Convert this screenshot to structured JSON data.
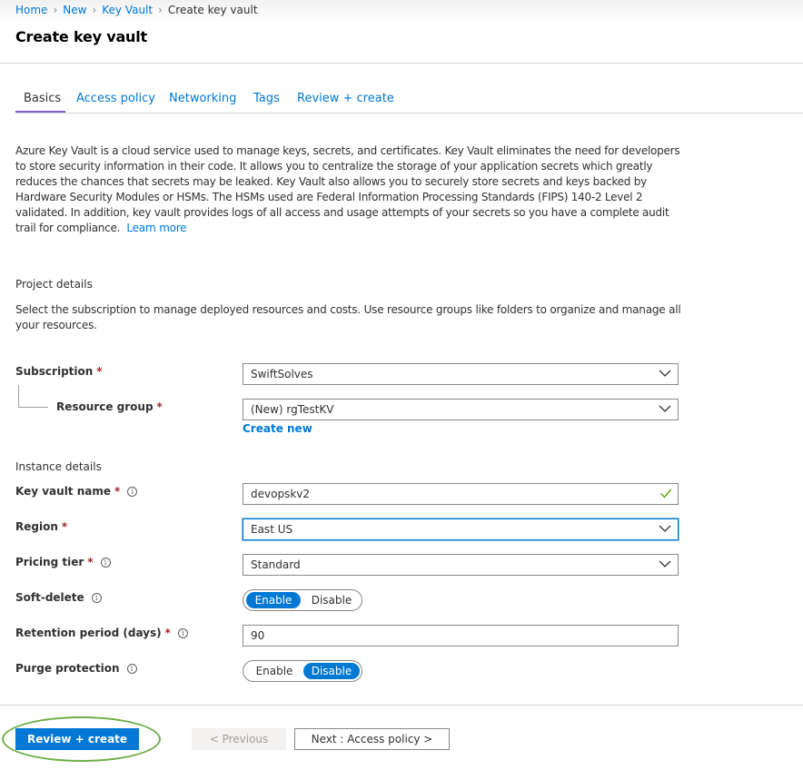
{
  "breadcrumb": [
    "Home",
    "New",
    "Key Vault",
    "Create key vault"
  ],
  "page_title": "Create key vault",
  "tabs": [
    {
      "label": "Basics",
      "active": true
    },
    {
      "label": "Access policy",
      "active": false
    },
    {
      "label": "Networking",
      "active": false
    },
    {
      "label": "Tags",
      "active": false
    },
    {
      "label": "Review + create",
      "active": false
    }
  ],
  "description": {
    "text": "Azure Key Vault is a cloud service used to manage keys, secrets, and certificates. Key Vault eliminates the need for developers to store security information in their code. It allows you to centralize the storage of your application secrets which greatly reduces the chances that secrets may be leaked. Key Vault also allows you to securely store secrets and keys backed by Hardware Security Modules or HSMs. The HSMs used are Federal Information Processing Standards (FIPS) 140-2 Level 2 validated. In addition, key vault provides logs of all access and usage attempts of your secrets so you have a complete audit trail for compliance.",
    "learn_more": "Learn more"
  },
  "project_details": {
    "heading": "Project details",
    "text": "Select the subscription to manage deployed resources and costs. Use resource groups like folders to organize and manage all your resources."
  },
  "subscription": {
    "label": "Subscription",
    "required_mark": "*",
    "value": "SwiftSolves"
  },
  "resource_group": {
    "label": "Resource group",
    "required_mark": "*",
    "value": "(New) rgTestKV",
    "create_new": "Create new"
  },
  "instance_details": {
    "heading": "Instance details"
  },
  "key_vault_name": {
    "label": "Key vault name",
    "required_mark": "*",
    "value": "devopskv2",
    "valid": true
  },
  "region": {
    "label": "Region",
    "required_mark": "*",
    "value": "East US"
  },
  "pricing_tier": {
    "label": "Pricing tier",
    "required_mark": "*",
    "value": "Standard"
  },
  "soft_delete": {
    "label": "Soft-delete",
    "enable": "Enable",
    "disable": "Disable",
    "selected": "Enable"
  },
  "retention_period": {
    "label": "Retention period (days)",
    "required_mark": "*",
    "value": "90"
  },
  "purge_protection": {
    "label": "Purge protection",
    "enable": "Enable",
    "disable": "Disable",
    "selected": "Disable"
  },
  "footer": {
    "review_create": "Review + create",
    "previous": "< Previous",
    "next": "Next : Access policy >"
  },
  "icons": {
    "info": "info-icon",
    "chevron": "chevron-down-icon",
    "check": "checkmark-icon"
  },
  "colors": {
    "accent": "#0078d4",
    "tab_underline": "#8661c5",
    "required": "#a4262c",
    "valid_check": "#57a300",
    "highlight": "#70ad47"
  }
}
